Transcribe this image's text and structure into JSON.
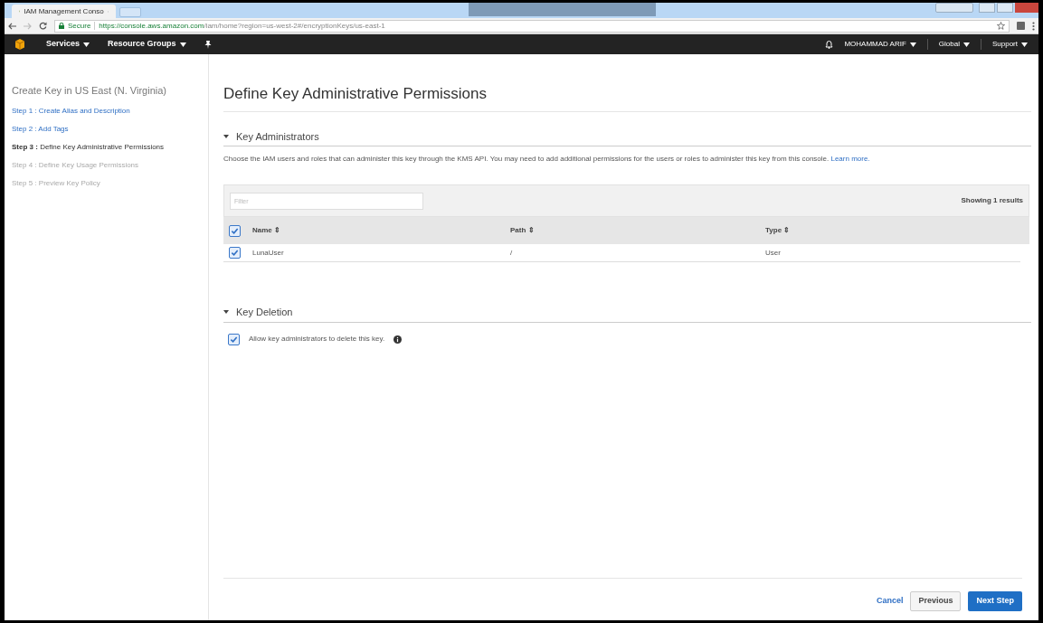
{
  "browser": {
    "tab_title": "IAM Management Conso",
    "secure_label": "Secure",
    "url_host": "https://console.aws.amazon.com",
    "url_path": "/iam/home?region=us-west-2#/encryptionKeys/us-east-1"
  },
  "nav": {
    "left": [
      {
        "label": "Services"
      },
      {
        "label": "Resource Groups"
      }
    ],
    "right": [
      {
        "label": "MOHAMMAD ARIF"
      },
      {
        "label": "Global"
      },
      {
        "label": "Support"
      }
    ]
  },
  "sidebar": {
    "title": "Create Key in US East (N. Virginia)",
    "steps": [
      {
        "prefix": "Step 1 :",
        "label": "Create Alias and Description",
        "disabled": false,
        "selected": false
      },
      {
        "prefix": "Step 2 :",
        "label": "Add Tags",
        "disabled": false,
        "selected": false
      },
      {
        "prefix": "Step 3 :",
        "label": "Define Key Administrative Permissions",
        "disabled": false,
        "selected": true
      },
      {
        "prefix": "Step 4 :",
        "label": "Define Key Usage Permissions",
        "disabled": true,
        "selected": false
      },
      {
        "prefix": "Step 5 :",
        "label": "Preview Key Policy",
        "disabled": true,
        "selected": false
      }
    ]
  },
  "page_title": "Define Key Administrative Permissions",
  "administrators": {
    "heading": "Key Administrators",
    "description": "Choose the IAM users and roles that can administer this key through the KMS API. You may need to add additional permissions for the users or roles to administer this key from this console.",
    "learn_more": "Learn more.",
    "filter_placeholder": "Filter",
    "results": "Showing 1 results",
    "select_all_checked": true,
    "columns": [
      "Name ⇕",
      "Path ⇕",
      "Type ⇕"
    ],
    "rows": [
      {
        "checked": true,
        "cells": [
          "LunaUser",
          "/",
          "User"
        ]
      }
    ]
  },
  "deletion": {
    "heading": "Key Deletion",
    "label": "Allow key administrators to delete this key.",
    "checked": true
  },
  "buttons": {
    "cancel": "Cancel",
    "previous": "Previous",
    "next": "Next Step"
  }
}
